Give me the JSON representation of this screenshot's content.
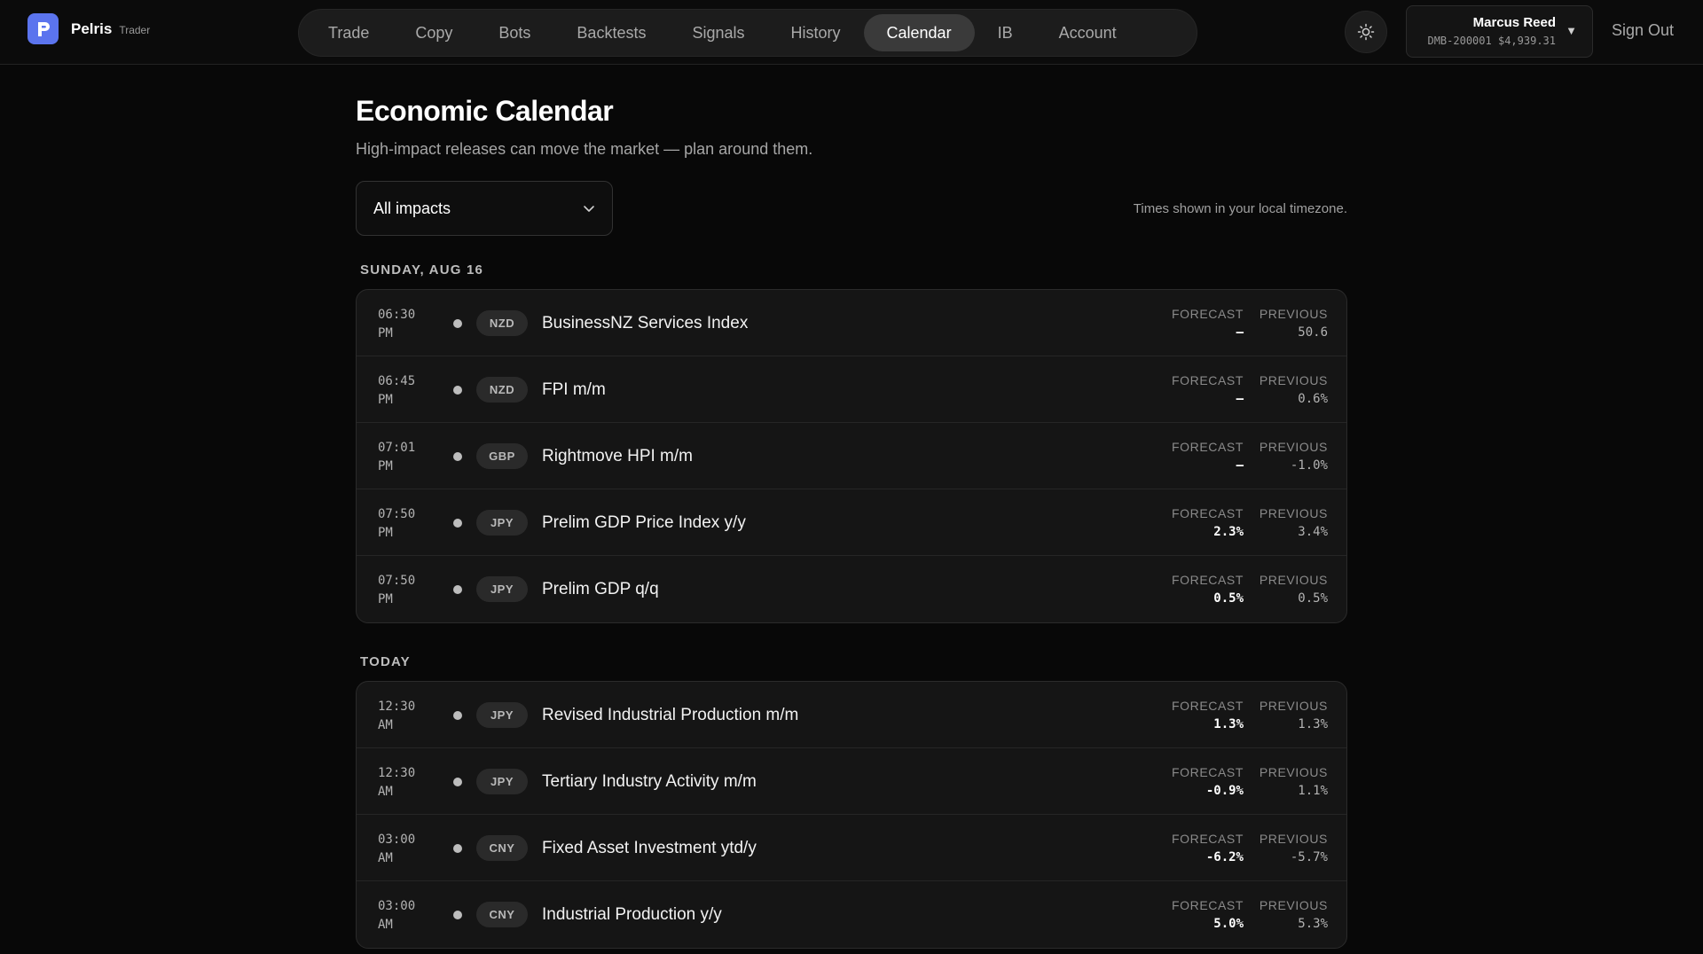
{
  "app": {
    "name": "Pelris",
    "tag": "Trader",
    "brand_color": "#5b74ee"
  },
  "nav": {
    "items": [
      {
        "label": "Trade",
        "active": false
      },
      {
        "label": "Copy",
        "active": false
      },
      {
        "label": "Bots",
        "active": false
      },
      {
        "label": "Backtests",
        "active": false
      },
      {
        "label": "Signals",
        "active": false
      },
      {
        "label": "History",
        "active": false
      },
      {
        "label": "Calendar",
        "active": true
      },
      {
        "label": "IB",
        "active": false
      },
      {
        "label": "Account",
        "active": false
      }
    ]
  },
  "theme_toggle": {
    "icon": "sun-icon"
  },
  "account": {
    "name": "Marcus Reed",
    "id": "DMB-200001",
    "balance": "$4,939.31",
    "caret": "▼"
  },
  "signout_label": "Sign Out",
  "page": {
    "title": "Economic Calendar",
    "subtitle": "High-impact releases can move the market — plan around them."
  },
  "filter": {
    "selected": "All impacts",
    "icon": "chevron-down-icon"
  },
  "timezone_note": "Times shown in your local timezone.",
  "column_labels": {
    "forecast": "FORECAST",
    "previous": "PREVIOUS"
  },
  "days": [
    {
      "label": "SUNDAY, AUG 16",
      "events": [
        {
          "time": "06:30",
          "ampm": "PM",
          "currency": "NZD",
          "title": "BusinessNZ Services Index",
          "forecast": "–",
          "previous": "50.6"
        },
        {
          "time": "06:45",
          "ampm": "PM",
          "currency": "NZD",
          "title": "FPI m/m",
          "forecast": "–",
          "previous": "0.6%"
        },
        {
          "time": "07:01",
          "ampm": "PM",
          "currency": "GBP",
          "title": "Rightmove HPI m/m",
          "forecast": "–",
          "previous": "-1.0%"
        },
        {
          "time": "07:50",
          "ampm": "PM",
          "currency": "JPY",
          "title": "Prelim GDP Price Index y/y",
          "forecast": "2.3%",
          "previous": "3.4%"
        },
        {
          "time": "07:50",
          "ampm": "PM",
          "currency": "JPY",
          "title": "Prelim GDP q/q",
          "forecast": "0.5%",
          "previous": "0.5%"
        }
      ]
    },
    {
      "label": "TODAY",
      "events": [
        {
          "time": "12:30",
          "ampm": "AM",
          "currency": "JPY",
          "title": "Revised Industrial Production m/m",
          "forecast": "1.3%",
          "previous": "1.3%"
        },
        {
          "time": "12:30",
          "ampm": "AM",
          "currency": "JPY",
          "title": "Tertiary Industry Activity m/m",
          "forecast": "-0.9%",
          "previous": "1.1%"
        },
        {
          "time": "03:00",
          "ampm": "AM",
          "currency": "CNY",
          "title": "Fixed Asset Investment ytd/y",
          "forecast": "-6.2%",
          "previous": "-5.7%"
        },
        {
          "time": "03:00",
          "ampm": "AM",
          "currency": "CNY",
          "title": "Industrial Production y/y",
          "forecast": "5.0%",
          "previous": "5.3%"
        }
      ]
    }
  ]
}
